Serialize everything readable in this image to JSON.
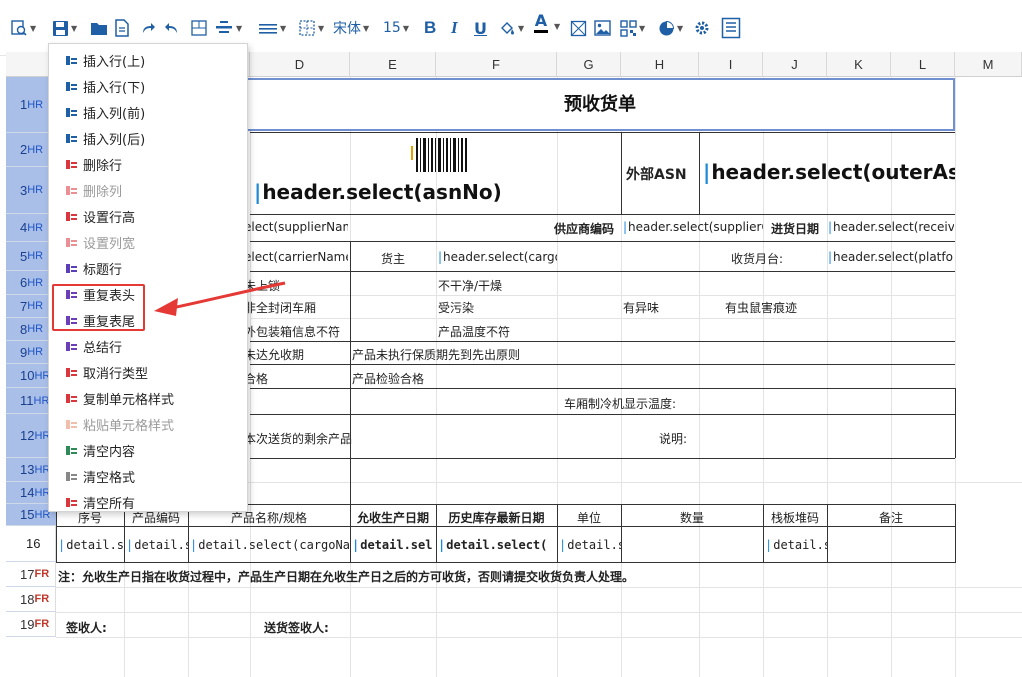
{
  "toolbar": {
    "font_name": "宋体",
    "font_size": "15",
    "bold_label": "B",
    "italic_label": "I",
    "underline_label": "U",
    "text_color_label": "A"
  },
  "columns": [
    "D",
    "E",
    "F",
    "G",
    "H",
    "I",
    "J",
    "K",
    "L",
    "M"
  ],
  "rows": [
    {
      "num": "1",
      "tag": "HR"
    },
    {
      "num": "2",
      "tag": "HR"
    },
    {
      "num": "3",
      "tag": "HR"
    },
    {
      "num": "4",
      "tag": "HR"
    },
    {
      "num": "5",
      "tag": "HR"
    },
    {
      "num": "6",
      "tag": "HR"
    },
    {
      "num": "7",
      "tag": "HR"
    },
    {
      "num": "8",
      "tag": "HR"
    },
    {
      "num": "9",
      "tag": "HR"
    },
    {
      "num": "10",
      "tag": "HR"
    },
    {
      "num": "11",
      "tag": "HR"
    },
    {
      "num": "12",
      "tag": "HR"
    },
    {
      "num": "13",
      "tag": "HR"
    },
    {
      "num": "14",
      "tag": "HR"
    },
    {
      "num": "15",
      "tag": "HR"
    },
    {
      "num": "16",
      "tag": ""
    },
    {
      "num": "17",
      "tag": "FR"
    },
    {
      "num": "18",
      "tag": "FR"
    },
    {
      "num": "19",
      "tag": "FR"
    }
  ],
  "cells": {
    "title": "预收货单",
    "asn_no": "header.select(asnNo)",
    "outer_asn_label": "外部ASN",
    "outer_asn_value": "header.select(outerAs",
    "supplier_name": "elect(supplierNam",
    "supplier_code_label": "供应商编码",
    "supplier_code_value": "header.select(supplierC",
    "arrive_date_label": "进货日期",
    "arrive_date_value": "header.select(receiv",
    "carrier_name": "elect(carrierName",
    "owner_label": "货主",
    "owner_value": "header.select(cargo",
    "platform_label": "收货月台:",
    "platform_value": "header.select(platfor",
    "r6_d": "未上锁",
    "r6_f": "不干净/干燥",
    "r7_d": "非全封闭车厢",
    "r7_f": "受污染",
    "r7_h": "有异味",
    "r7_i": "有虫鼠害痕迹",
    "r8_d": "外包装箱信息不符",
    "r8_f": "产品温度不符",
    "r9_d": "未达允收期",
    "r9_e": "产品未执行保质期先到先出原则",
    "r10_d": "合格",
    "r10_e": "产品检验合格",
    "r11_g": "车厢制冷机显示温度:",
    "r12_d": "本次送货的剩余产品",
    "r12_h": "说明:",
    "h_seq": "序号",
    "h_code": "产品编码",
    "h_name": "产品名称/规格",
    "h_allow": "允收生产日期",
    "h_hist": "历史库存最新日期",
    "h_unit": "单位",
    "h_qty": "数量",
    "h_pallet": "栈板堆码",
    "h_remark": "备注",
    "d_b": "detail.se",
    "d_c": "detail.s",
    "d_d": "detail.select(cargoNam",
    "d_e": "detail.sel",
    "d_f": "detail.select(",
    "d_g": "detail.s",
    "d_j": "detail.s",
    "note": "注：允收生产日指在收货过程中，产品生产日期在允收生产日之后的方可收货，否则请提交收货负责人处理。",
    "receiver_label": "签收人:",
    "sender_label": "送货签收人:"
  },
  "menu": {
    "items": [
      {
        "label": "插入行(上)",
        "enabled": true,
        "icon": "insert-row-above-icon"
      },
      {
        "label": "插入行(下)",
        "enabled": true,
        "icon": "insert-row-below-icon"
      },
      {
        "label": "插入列(前)",
        "enabled": true,
        "icon": "insert-col-before-icon"
      },
      {
        "label": "插入列(后)",
        "enabled": true,
        "icon": "insert-col-after-icon"
      },
      {
        "label": "删除行",
        "enabled": true,
        "icon": "delete-row-icon"
      },
      {
        "label": "删除列",
        "enabled": false,
        "icon": "delete-col-icon"
      },
      {
        "label": "设置行高",
        "enabled": true,
        "icon": "row-height-icon"
      },
      {
        "label": "设置列宽",
        "enabled": false,
        "icon": "col-width-icon"
      },
      {
        "label": "标题行",
        "enabled": true,
        "icon": "bookmark-icon"
      },
      {
        "label": "重复表头",
        "enabled": true,
        "icon": "repeat-header-icon"
      },
      {
        "label": "重复表尾",
        "enabled": true,
        "icon": "repeat-footer-icon"
      },
      {
        "label": "总结行",
        "enabled": true,
        "icon": "summary-row-icon"
      },
      {
        "label": "取消行类型",
        "enabled": true,
        "icon": "cancel-row-type-icon"
      },
      {
        "label": "复制单元格样式",
        "enabled": true,
        "icon": "copy-style-icon"
      },
      {
        "label": "粘贴单元格样式",
        "enabled": false,
        "icon": "paste-style-icon"
      },
      {
        "label": "清空内容",
        "enabled": true,
        "icon": "clear-content-icon"
      },
      {
        "label": "清空格式",
        "enabled": true,
        "icon": "clear-format-icon"
      },
      {
        "label": "清空所有",
        "enabled": true,
        "icon": "clear-all-icon"
      }
    ]
  },
  "colors": {
    "accent": "#1f5fa5",
    "header_row": "#a9bfe8",
    "highlight": "#e53935"
  }
}
